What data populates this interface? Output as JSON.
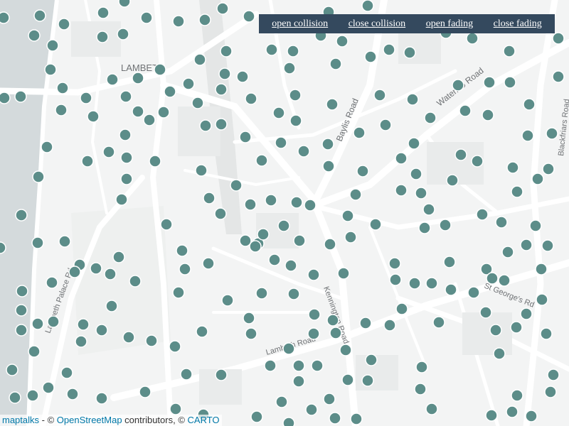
{
  "toolbar": {
    "open_collision": "open collision",
    "close_collision": "close collision",
    "open_fading": "open fading",
    "close_fading": "close fading"
  },
  "attribution": {
    "brand": "maptalks",
    "sep1": " - © ",
    "osm": "OpenStreetMap",
    "sep2": " contributors, © ",
    "carto": "CARTO"
  },
  "map_labels": {
    "district": "LAMBETH",
    "baylis_road": "Baylis Road",
    "waterloo_road": "Waterloo Road",
    "lambeth_palace_rd": "Lambeth Palace Rd",
    "kennington_road": "Kennington Road",
    "lambeth_road": "Lambeth Road",
    "st_georges_rd": "St George's Rd",
    "blackfriars_road": "Blackfriars Road"
  },
  "colors": {
    "marker_fill": "#5c8d89",
    "marker_stroke": "#ffffff",
    "water": "#d4dadc",
    "road": "#ffffff",
    "toolbar_bg": "#34495e"
  }
}
